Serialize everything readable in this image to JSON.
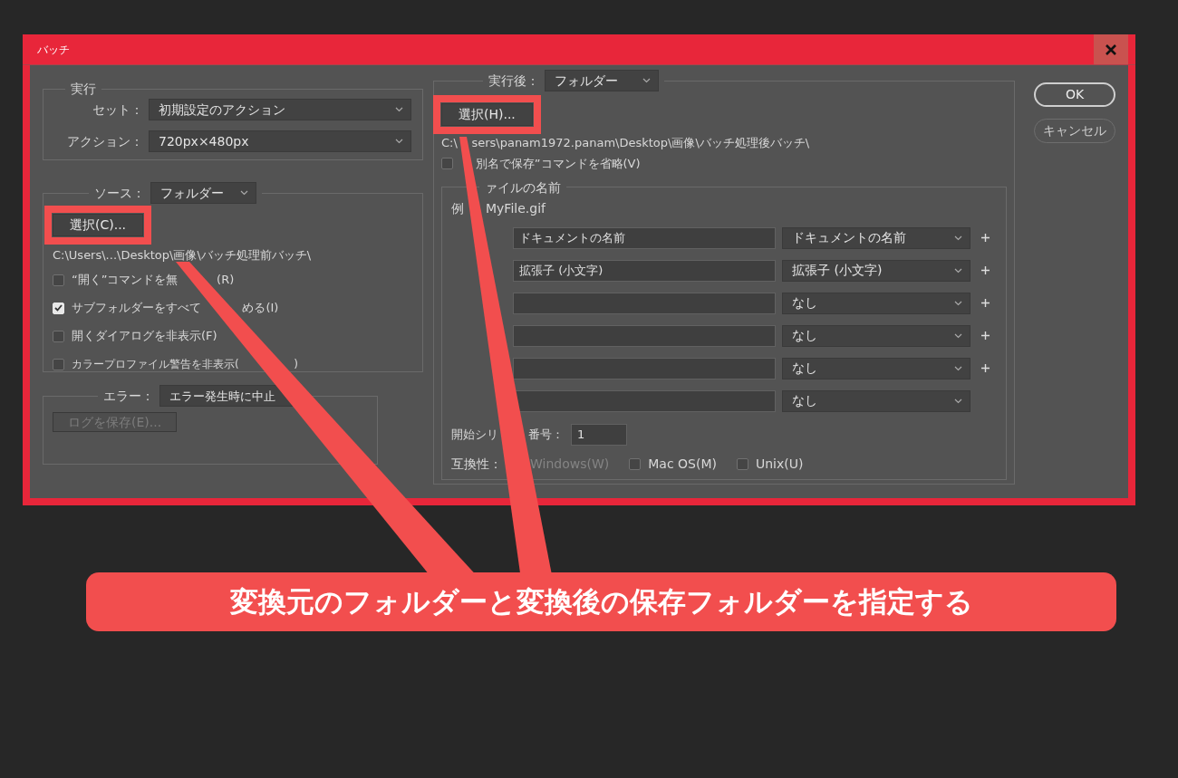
{
  "window": {
    "title": "バッチ"
  },
  "play": {
    "legend": "実行",
    "fields": [
      {
        "label": "セット：",
        "value": "初期設定のアクション"
      },
      {
        "label": "アクション：",
        "value": "720px×480px"
      }
    ]
  },
  "source": {
    "label": "ソース：",
    "value": "フォルダー",
    "choose_button": "選択(C)...",
    "highlighted": true,
    "path": "C:\\Users\\...\\Desktop\\画像\\バッチ処理前バッチ\\",
    "options": [
      {
        "label": "“開く”コマンドを無",
        "label_after": "(R)",
        "checked": false
      },
      {
        "label": "サブフォルダーをすべて",
        "label_after": "める(I)",
        "checked": true
      },
      {
        "label": "開くダイアログを非表示(F)",
        "checked": false
      },
      {
        "label": "カラープロファイル警告を非表示(",
        "label_after": ")",
        "checked": false
      }
    ]
  },
  "errors": {
    "label": "エラー：",
    "value": "エラー発生時に中止",
    "log_button": "ログを保存(E)...",
    "log_disabled": true
  },
  "destination": {
    "label": "実行後：",
    "value": "フォルダー",
    "choose_button": "選択(H)...",
    "highlighted": true,
    "path": "C:\\",
    "path_after": "sers\\panam1972.panam\\Desktop\\画像\\バッチ処理後バッチ\\",
    "override_option": {
      "label": "別名で保存”コマンドを省略(V)",
      "checked": false
    },
    "naming": {
      "legend": "ァイルの名前",
      "example_label": "例",
      "example": "MyFile.gif",
      "rows": [
        {
          "text": "ドキュメントの名前",
          "choice": "ドキュメントの名前",
          "addable": true
        },
        {
          "text": "拡張子 (小文字)",
          "choice": "拡張子 (小文字)",
          "addable": true
        },
        {
          "choice": "なし",
          "addable": true
        },
        {
          "choice": "なし",
          "addable": true
        },
        {
          "choice": "なし",
          "addable": true
        },
        {
          "choice": "なし",
          "addable": false
        }
      ],
      "serial_label": "開始シリ",
      "serial_label_rest": "番号：",
      "serial_value": "1",
      "compat_label": "互換性：",
      "compat": [
        {
          "label": "Windows(W)",
          "disabled": true
        },
        {
          "label": "Mac OS(M)",
          "checked": false,
          "disabled": false
        },
        {
          "label": "Unix(U)",
          "checked": false,
          "disabled": false
        }
      ]
    }
  },
  "buttons": [
    {
      "label": "OK",
      "default": true
    },
    {
      "label": "キャンセル",
      "default": false
    }
  ],
  "callout": {
    "text": "変換元のフォルダーと変換後の保存フォルダーを指定する"
  }
}
